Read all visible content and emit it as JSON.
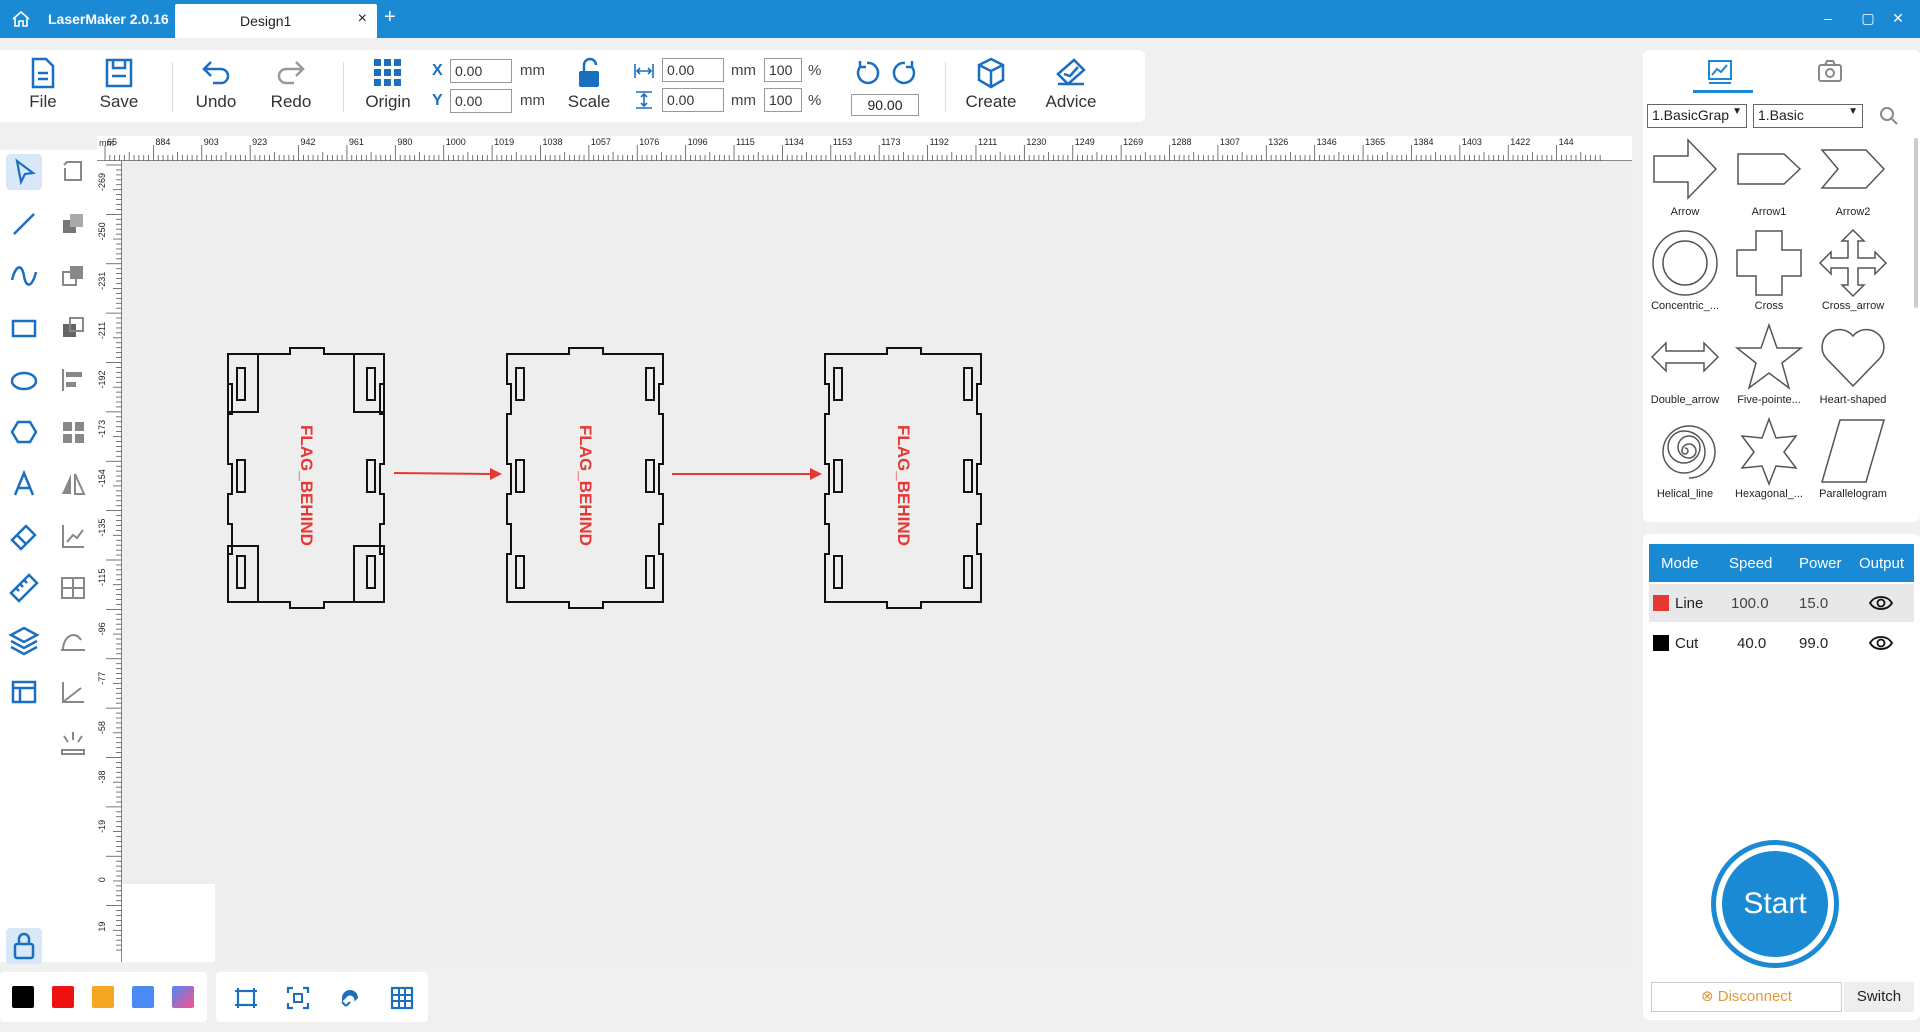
{
  "titlebar": {
    "app_name": "LaserMaker 2.0.16",
    "tab_label": "Design1",
    "tab_close": "×",
    "add_tab": "+",
    "minimize": "–",
    "restore": "▢",
    "close": "✕",
    "bg_color": "#1a8ad4"
  },
  "toolbar": {
    "file_label": "File",
    "save_label": "Save",
    "undo_label": "Undo",
    "redo_label": "Redo",
    "origin_label": "Origin",
    "scale_label": "Scale",
    "create_label": "Create",
    "advice_label": "Advice",
    "x_label": "X",
    "y_label": "Y",
    "x_value": "0.00",
    "y_value": "0.00",
    "width_value": "0.00",
    "height_value": "0.00",
    "width_pct": "100",
    "height_pct": "100",
    "unit_mm": "mm",
    "unit_pct": "%",
    "rotate_value": "90.00",
    "accent_color": "#1a6fc0"
  },
  "left_tools": [
    "select-tool",
    "node-edit-tool",
    "line-tool",
    "combine-tool",
    "curve-tool",
    "copy-tool",
    "rectangle-tool",
    "group-tool",
    "ellipse-tool",
    "align-tool",
    "polygon-tool",
    "array-tool",
    "text-tool",
    "mirror-tool",
    "eraser-tool",
    "chart-tool",
    "measure-tool",
    "layout-tool",
    "layers-tool",
    "stamp-tool",
    "table-tool",
    "path-tool",
    "light-tool"
  ],
  "ruler": {
    "unit": "mm",
    "top_ticks": [
      "65",
      "884",
      "903",
      "923",
      "942",
      "961",
      "980",
      "1000",
      "1019",
      "1038",
      "1057",
      "1076",
      "1096",
      "1115",
      "1134",
      "1153",
      "1173",
      "1192",
      "1211",
      "1230",
      "1249",
      "1269",
      "1288",
      "1307",
      "1326",
      "1346",
      "1365",
      "1384",
      "1403",
      "1422",
      "144"
    ],
    "left_ticks": [
      "-269",
      "-250",
      "-231",
      "-211",
      "-192",
      "-173",
      "-154",
      "-135",
      "-115",
      "-96",
      "-77",
      "-58",
      "-38",
      "-19",
      "0",
      "19"
    ]
  },
  "canvas": {
    "part_text": "FLAG_BEHIND",
    "line_color": "#e53935"
  },
  "colors": {
    "swatches": [
      "#000000",
      "#ee1111",
      "#f5a623",
      "#4a8af4",
      "gradient"
    ]
  },
  "bottom_tools": [
    "fit-frame-icon",
    "focus-icon",
    "magnet-icon",
    "grid-icon"
  ],
  "library": {
    "category_select": "1.BasicGrap",
    "sub_select": "1.Basic",
    "shapes": [
      {
        "label": "Arrow",
        "icon": "arrow-shape-icon"
      },
      {
        "label": "Arrow1",
        "icon": "arrow1-shape-icon"
      },
      {
        "label": "Arrow2",
        "icon": "arrow2-shape-icon"
      },
      {
        "label": "Concentric_...",
        "icon": "concentric-shape-icon"
      },
      {
        "label": "Cross",
        "icon": "cross-shape-icon"
      },
      {
        "label": "Cross_arrow",
        "icon": "cross-arrow-shape-icon"
      },
      {
        "label": "Double_arrow",
        "icon": "double-arrow-shape-icon"
      },
      {
        "label": "Five-pointe...",
        "icon": "five-star-shape-icon"
      },
      {
        "label": "Heart-shaped",
        "icon": "heart-shape-icon"
      },
      {
        "label": "Helical_line",
        "icon": "helical-shape-icon"
      },
      {
        "label": "Hexagonal_...",
        "icon": "hexagonal-star-shape-icon"
      },
      {
        "label": "Parallelogram",
        "icon": "parallelogram-shape-icon"
      }
    ]
  },
  "layers": {
    "headers": [
      "Mode",
      "Speed",
      "Power",
      "Output"
    ],
    "rows": [
      {
        "mode": "Line",
        "speed": "100.0",
        "power": "15.0",
        "color": "#e53935"
      },
      {
        "mode": "Cut",
        "speed": "40.0",
        "power": "99.0",
        "color": "#000000"
      }
    ]
  },
  "controls": {
    "start_label": "Start",
    "disconnect_label": "Disconnect",
    "switch_label": "Switch"
  }
}
